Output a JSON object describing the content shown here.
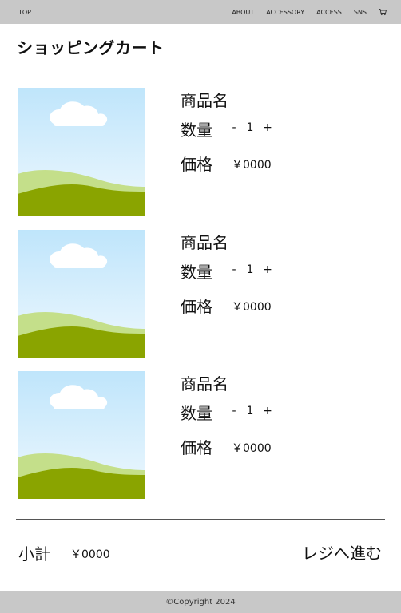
{
  "header": {
    "top_link": "TOP",
    "nav": [
      "ABOUT",
      "ACCESSORY",
      "ACCESS",
      "SNS"
    ],
    "cart_icon": "cart-icon"
  },
  "page_title": "ショッピングカート",
  "items": [
    {
      "name": "商品名",
      "qty_label": "数量",
      "minus": "-",
      "qty": "1",
      "plus": "+",
      "price_label": "価格",
      "price": "￥0000",
      "image_icon": "landscape-image"
    },
    {
      "name": "商品名",
      "qty_label": "数量",
      "minus": "-",
      "qty": "1",
      "plus": "+",
      "price_label": "価格",
      "price": "￥0000",
      "image_icon": "landscape-image"
    },
    {
      "name": "商品名",
      "qty_label": "数量",
      "minus": "-",
      "qty": "1",
      "plus": "+",
      "price_label": "価格",
      "price": "￥0000",
      "image_icon": "landscape-image"
    }
  ],
  "summary": {
    "subtotal_label": "小計",
    "subtotal": "￥0000",
    "checkout": "レジへ進む"
  },
  "footer": {
    "copyright": "©Copyright 2024"
  },
  "colors": {
    "bar_gray": "#c8c8c8",
    "sky": "#cfeafb",
    "hill_light": "#c4df8a",
    "hill_dark": "#8aa400"
  }
}
